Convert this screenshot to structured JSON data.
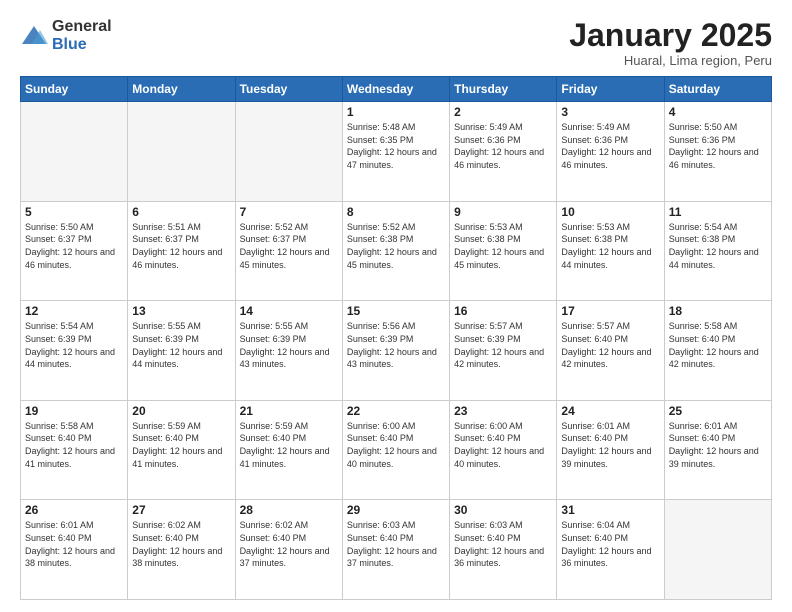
{
  "header": {
    "logo_general": "General",
    "logo_blue": "Blue",
    "month_title": "January 2025",
    "subtitle": "Huaral, Lima region, Peru"
  },
  "weekdays": [
    "Sunday",
    "Monday",
    "Tuesday",
    "Wednesday",
    "Thursday",
    "Friday",
    "Saturday"
  ],
  "weeks": [
    [
      {
        "day": "",
        "sunrise": "",
        "sunset": "",
        "daylight": ""
      },
      {
        "day": "",
        "sunrise": "",
        "sunset": "",
        "daylight": ""
      },
      {
        "day": "",
        "sunrise": "",
        "sunset": "",
        "daylight": ""
      },
      {
        "day": "1",
        "sunrise": "Sunrise: 5:48 AM",
        "sunset": "Sunset: 6:35 PM",
        "daylight": "Daylight: 12 hours and 47 minutes."
      },
      {
        "day": "2",
        "sunrise": "Sunrise: 5:49 AM",
        "sunset": "Sunset: 6:36 PM",
        "daylight": "Daylight: 12 hours and 46 minutes."
      },
      {
        "day": "3",
        "sunrise": "Sunrise: 5:49 AM",
        "sunset": "Sunset: 6:36 PM",
        "daylight": "Daylight: 12 hours and 46 minutes."
      },
      {
        "day": "4",
        "sunrise": "Sunrise: 5:50 AM",
        "sunset": "Sunset: 6:36 PM",
        "daylight": "Daylight: 12 hours and 46 minutes."
      }
    ],
    [
      {
        "day": "5",
        "sunrise": "Sunrise: 5:50 AM",
        "sunset": "Sunset: 6:37 PM",
        "daylight": "Daylight: 12 hours and 46 minutes."
      },
      {
        "day": "6",
        "sunrise": "Sunrise: 5:51 AM",
        "sunset": "Sunset: 6:37 PM",
        "daylight": "Daylight: 12 hours and 46 minutes."
      },
      {
        "day": "7",
        "sunrise": "Sunrise: 5:52 AM",
        "sunset": "Sunset: 6:37 PM",
        "daylight": "Daylight: 12 hours and 45 minutes."
      },
      {
        "day": "8",
        "sunrise": "Sunrise: 5:52 AM",
        "sunset": "Sunset: 6:38 PM",
        "daylight": "Daylight: 12 hours and 45 minutes."
      },
      {
        "day": "9",
        "sunrise": "Sunrise: 5:53 AM",
        "sunset": "Sunset: 6:38 PM",
        "daylight": "Daylight: 12 hours and 45 minutes."
      },
      {
        "day": "10",
        "sunrise": "Sunrise: 5:53 AM",
        "sunset": "Sunset: 6:38 PM",
        "daylight": "Daylight: 12 hours and 44 minutes."
      },
      {
        "day": "11",
        "sunrise": "Sunrise: 5:54 AM",
        "sunset": "Sunset: 6:38 PM",
        "daylight": "Daylight: 12 hours and 44 minutes."
      }
    ],
    [
      {
        "day": "12",
        "sunrise": "Sunrise: 5:54 AM",
        "sunset": "Sunset: 6:39 PM",
        "daylight": "Daylight: 12 hours and 44 minutes."
      },
      {
        "day": "13",
        "sunrise": "Sunrise: 5:55 AM",
        "sunset": "Sunset: 6:39 PM",
        "daylight": "Daylight: 12 hours and 44 minutes."
      },
      {
        "day": "14",
        "sunrise": "Sunrise: 5:55 AM",
        "sunset": "Sunset: 6:39 PM",
        "daylight": "Daylight: 12 hours and 43 minutes."
      },
      {
        "day": "15",
        "sunrise": "Sunrise: 5:56 AM",
        "sunset": "Sunset: 6:39 PM",
        "daylight": "Daylight: 12 hours and 43 minutes."
      },
      {
        "day": "16",
        "sunrise": "Sunrise: 5:57 AM",
        "sunset": "Sunset: 6:39 PM",
        "daylight": "Daylight: 12 hours and 42 minutes."
      },
      {
        "day": "17",
        "sunrise": "Sunrise: 5:57 AM",
        "sunset": "Sunset: 6:40 PM",
        "daylight": "Daylight: 12 hours and 42 minutes."
      },
      {
        "day": "18",
        "sunrise": "Sunrise: 5:58 AM",
        "sunset": "Sunset: 6:40 PM",
        "daylight": "Daylight: 12 hours and 42 minutes."
      }
    ],
    [
      {
        "day": "19",
        "sunrise": "Sunrise: 5:58 AM",
        "sunset": "Sunset: 6:40 PM",
        "daylight": "Daylight: 12 hours and 41 minutes."
      },
      {
        "day": "20",
        "sunrise": "Sunrise: 5:59 AM",
        "sunset": "Sunset: 6:40 PM",
        "daylight": "Daylight: 12 hours and 41 minutes."
      },
      {
        "day": "21",
        "sunrise": "Sunrise: 5:59 AM",
        "sunset": "Sunset: 6:40 PM",
        "daylight": "Daylight: 12 hours and 41 minutes."
      },
      {
        "day": "22",
        "sunrise": "Sunrise: 6:00 AM",
        "sunset": "Sunset: 6:40 PM",
        "daylight": "Daylight: 12 hours and 40 minutes."
      },
      {
        "day": "23",
        "sunrise": "Sunrise: 6:00 AM",
        "sunset": "Sunset: 6:40 PM",
        "daylight": "Daylight: 12 hours and 40 minutes."
      },
      {
        "day": "24",
        "sunrise": "Sunrise: 6:01 AM",
        "sunset": "Sunset: 6:40 PM",
        "daylight": "Daylight: 12 hours and 39 minutes."
      },
      {
        "day": "25",
        "sunrise": "Sunrise: 6:01 AM",
        "sunset": "Sunset: 6:40 PM",
        "daylight": "Daylight: 12 hours and 39 minutes."
      }
    ],
    [
      {
        "day": "26",
        "sunrise": "Sunrise: 6:01 AM",
        "sunset": "Sunset: 6:40 PM",
        "daylight": "Daylight: 12 hours and 38 minutes."
      },
      {
        "day": "27",
        "sunrise": "Sunrise: 6:02 AM",
        "sunset": "Sunset: 6:40 PM",
        "daylight": "Daylight: 12 hours and 38 minutes."
      },
      {
        "day": "28",
        "sunrise": "Sunrise: 6:02 AM",
        "sunset": "Sunset: 6:40 PM",
        "daylight": "Daylight: 12 hours and 37 minutes."
      },
      {
        "day": "29",
        "sunrise": "Sunrise: 6:03 AM",
        "sunset": "Sunset: 6:40 PM",
        "daylight": "Daylight: 12 hours and 37 minutes."
      },
      {
        "day": "30",
        "sunrise": "Sunrise: 6:03 AM",
        "sunset": "Sunset: 6:40 PM",
        "daylight": "Daylight: 12 hours and 36 minutes."
      },
      {
        "day": "31",
        "sunrise": "Sunrise: 6:04 AM",
        "sunset": "Sunset: 6:40 PM",
        "daylight": "Daylight: 12 hours and 36 minutes."
      },
      {
        "day": "",
        "sunrise": "",
        "sunset": "",
        "daylight": ""
      }
    ]
  ]
}
